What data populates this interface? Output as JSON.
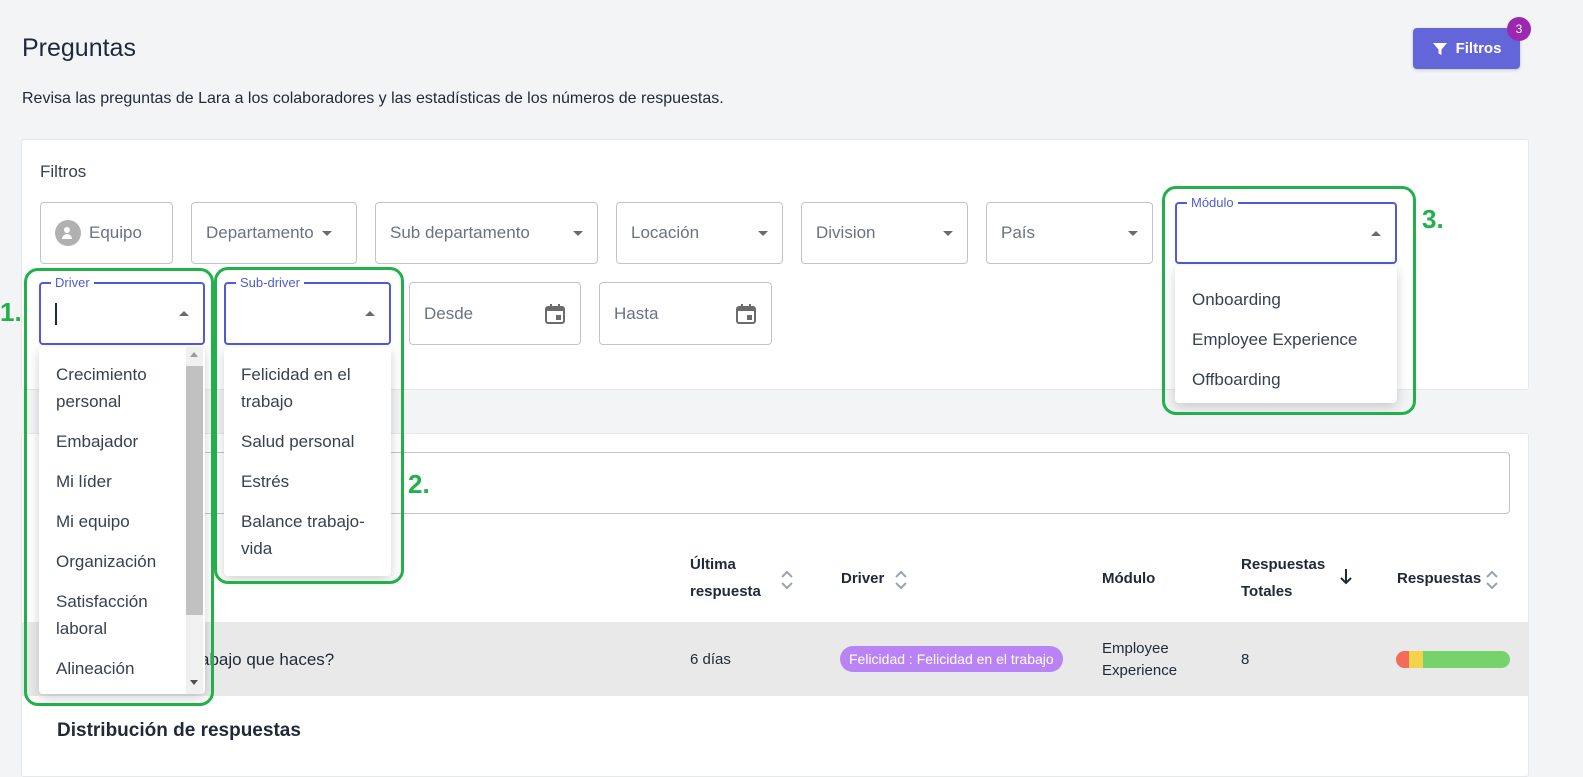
{
  "header": {
    "title": "Preguntas",
    "subtitle": "Revisa las preguntas de Lara a los colaboradores y las estadísticas de los números de respuestas.",
    "filter_button": "Filtros",
    "filter_count": "3"
  },
  "filters": {
    "heading": "Filtros",
    "equipo": "Equipo",
    "departamento": "Departamento",
    "sub_departamento": "Sub departamento",
    "locacion": "Locación",
    "division": "Division",
    "pais": "País",
    "modulo_label": "Módulo",
    "driver_label": "Driver",
    "subdriver_label": "Sub-driver",
    "desde": "Desde",
    "hasta": "Hasta"
  },
  "driver_options": [
    "Crecimiento personal",
    "Embajador",
    "Mi líder",
    "Mi equipo",
    "Organización",
    "Satisfacción laboral",
    "Alineación"
  ],
  "subdriver_options": [
    "Felicidad en el trabajo",
    "Salud personal",
    "Estrés",
    "Balance trabajo-vida"
  ],
  "modulo_options": [
    "Onboarding",
    "Employee Experience",
    "Offboarding"
  ],
  "annotations": [
    "1.",
    "2.",
    "3."
  ],
  "table": {
    "col_ultima": "Última respuesta",
    "col_driver": "Driver",
    "col_modulo": "Módulo",
    "col_totales": "Respuestas Totales",
    "col_respuestas": "Respuestas",
    "row": {
      "question_fragment": "abajo que haces?",
      "ultima": "6 días",
      "driver_chip": "Felicidad : Felicidad en el trabajo",
      "modulo": "Employee Experience",
      "totales": "8"
    },
    "distribution_title": "Distribución de respuestas"
  },
  "colors": {
    "accent": "#6366d9",
    "badge": "#9c27b0",
    "annotation": "#22b04b",
    "chip": "#b983f5"
  }
}
